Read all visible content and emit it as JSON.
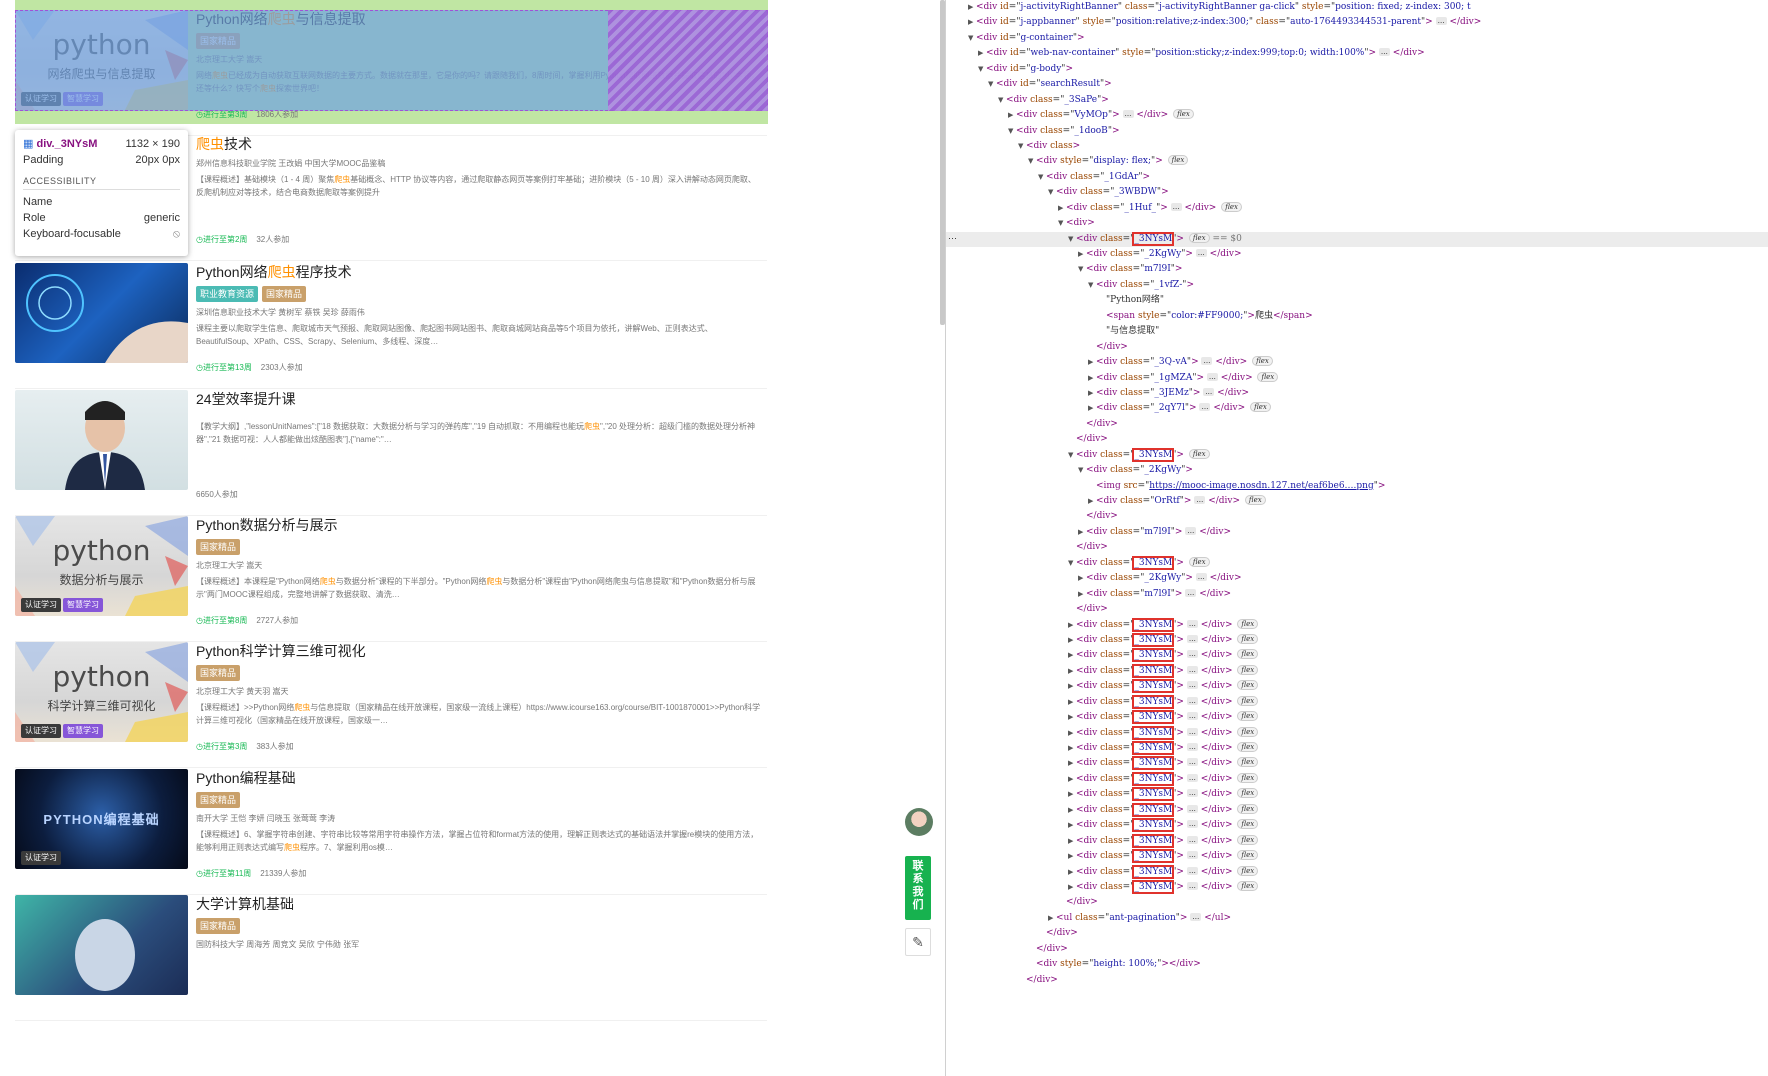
{
  "overlay": {
    "selector": "div._3NYsM",
    "size": "1132 × 190",
    "padding_label": "Padding",
    "padding_value": "20px 0px",
    "section": "ACCESSIBILITY",
    "name_label": "Name",
    "name_value": "",
    "role_label": "Role",
    "role_value": "generic",
    "kf_label": "Keyboard-focusable",
    "kf_icon": "no-entry-icon"
  },
  "courses": [
    {
      "thumb": "python",
      "thumb_word": "python",
      "thumb_sub": "网络爬虫与信息提取",
      "cert": "认证学习",
      "smart": "智慧学习",
      "title_pre": "Python网络",
      "title_hl": "爬虫",
      "title_post": "与信息提取",
      "tags": [
        "国家精品"
      ],
      "teachers": "北京理工大学  嵩天",
      "desc_pre": "网络",
      "desc_hl": "爬虫",
      "desc_post": "已经成为自动获取互联网数据的主要方式。数据就在那里，它是你的吗？请跟随我们，8周时间，掌握利用Python爬取网络数据并提取信息的\"小\"本领，还等什么？快写个",
      "desc_hl2": "爬虫",
      "desc_post2": "探索世界吧！",
      "progress": "进行至第3周",
      "joined": "1806人参加"
    },
    {
      "thumb": "none",
      "title_pre": "",
      "title_hl": "爬虫",
      "title_post": "技术",
      "tags": [],
      "teachers": "郑州信息科技职业学院  王改娟  中国大学MOOC品鉴稿",
      "desc_pre": "【课程概述】基础模块（1 - 4 周）聚焦",
      "desc_hl": "爬虫",
      "desc_post": "基础概念、HTTP 协议等内容，通过爬取静态网页等案例打牢基础；进阶模块（5 - 10 周）深入讲解动态网页爬取、反爬机制应对等技术，结合电商数据爬取等案例提升",
      "desc_hl2": "",
      "desc_post2": "",
      "progress": "进行至第2周",
      "joined": "32人参加"
    },
    {
      "thumb": "tech",
      "title_pre": "Python网络",
      "title_hl": "爬虫",
      "title_post": "程序技术",
      "tags": [
        "职业教育资源",
        "国家精品"
      ],
      "teachers": "深圳信息职业技术大学  黄树军  蔡铁  吴珍  薛雨伟",
      "desc_pre": "课程主要以爬取学生信息、爬取城市天气预报、爬取网站图像、爬起图书网站图书、爬取商城网站商品等5个项目为依托，讲解Web、正则表达式、BeautifulSoup、XPath、CSS、Scrapy、Selenium、多线程、深度…",
      "desc_hl": "",
      "desc_post": "",
      "desc_hl2": "",
      "desc_post2": "",
      "progress": "进行至第13周",
      "joined": "2303人参加"
    },
    {
      "thumb": "person",
      "title_pre": "24堂效率提升课",
      "title_hl": "",
      "title_post": "",
      "tags": [],
      "teachers": "",
      "desc_pre": "【教学大纲】,\"lessonUnitNames\":[\"18 数据获取：大数据分析与学习的弹药库\",\"19 自动抓取：不用编程也能玩",
      "desc_hl": "爬虫",
      "desc_post": "\",\"20 处理分析：超级门槛的数据处理分析神器\",\"21 数据可视：人人都能做出炫酷图表\"],{\"name\":\"…",
      "desc_hl2": "",
      "desc_post2": "",
      "progress": "",
      "joined": "6650人参加"
    },
    {
      "thumb": "python",
      "thumb_word": "python",
      "thumb_sub": "数据分析与展示",
      "cert": "认证学习",
      "smart": "智慧学习",
      "title_pre": "Python数据分析与展示",
      "title_hl": "",
      "title_post": "",
      "tags": [
        "国家精品"
      ],
      "teachers": "北京理工大学  嵩天",
      "desc_pre": "【课程概述】本课程是\"Python网络",
      "desc_hl": "爬虫",
      "desc_post": "与数据分析\"课程的下半部分。\"Python网络",
      "desc_hl2": "爬虫",
      "desc_post2": "与数据分析\"课程由\"Python网络爬虫与信息提取\"和\"Python数据分析与展示\"两门MOOC课程组成，完整地讲解了数据获取、清洗…",
      "progress": "进行至第8周",
      "joined": "2727人参加"
    },
    {
      "thumb": "python",
      "thumb_word": "python",
      "thumb_sub": "科学计算三维可视化",
      "cert": "认证学习",
      "smart": "智慧学习",
      "title_pre": "Python科学计算三维可视化",
      "title_hl": "",
      "title_post": "",
      "tags": [
        "国家精品"
      ],
      "teachers": "北京理工大学  黄天羽  嵩天",
      "desc_pre": "【课程概述】>>Python网络",
      "desc_hl": "爬虫",
      "desc_post": "与信息提取（国家精品在线开放课程，国家级一流线上课程）https://www.icourse163.org/course/BIT-1001870001>>Python科学计算三维可视化（国家精品在线开放课程，国家级一…",
      "desc_hl2": "",
      "desc_post2": "",
      "progress": "进行至第3周",
      "joined": "383人参加"
    },
    {
      "thumb": "dark",
      "thumb_word": "PYTHON编程基础",
      "cert": "认证学习",
      "title_pre": "Python编程基础",
      "title_hl": "",
      "title_post": "",
      "tags": [
        "国家精品"
      ],
      "teachers": "南开大学  王恺  李妍  闫晓玉  张莺莺  李涛",
      "desc_pre": "【课程概述】6、掌握字符串创建、字符串比较等常用字符串操作方法，掌握占位符和format方法的使用，理解正则表达式的基础语法并掌握re模块的使用方法，能够利用正则表达式编写",
      "desc_hl": "爬虫",
      "desc_post": "程序。7、掌握利用os模…",
      "desc_hl2": "",
      "desc_post2": "",
      "progress": "进行至第11周",
      "joined": "21339人参加"
    },
    {
      "thumb": "robot",
      "title_pre": "大学计算机基础",
      "title_hl": "",
      "title_post": "",
      "tags": [
        "国家精品"
      ],
      "teachers": "国防科技大学  周海芳  周竞文  吴欣  宁伟勋  张军",
      "desc_pre": "",
      "desc_hl": "",
      "desc_post": "",
      "desc_hl2": "",
      "desc_post2": "",
      "progress": "",
      "joined": ""
    }
  ],
  "side": {
    "contact": "联系我们",
    "feedback_icon": "edit-icon"
  },
  "devtools": {
    "lines": [
      {
        "i": 0,
        "t": "▶",
        "h": "<span class=\"tg\">&lt;div</span> <span class=\"an\">id</span>=\"<span class=\"av\">j-activityRightBanner</span>\" <span class=\"an\">class</span>=\"<span class=\"av\">j-activityRightBanner ga-click</span>\" <span class=\"an\">style</span>=\"<span class=\"av\">position: fixed; z-index: 300; t</span>"
      },
      {
        "i": 0,
        "t": "▶",
        "h": "<span class=\"tg\">&lt;div</span> <span class=\"an\">id</span>=\"<span class=\"av\">j-appbanner</span>\" <span class=\"an\">style</span>=\"<span class=\"av\">position:relative;z-index:300;</span>\" <span class=\"an\">class</span>=\"<span class=\"av\">auto-1764493344531-parent</span>\"<span class=\"tg\">&gt;</span> <i class=\"ell\">…</i> <span class=\"tg\">&lt;/div&gt;</span>"
      },
      {
        "i": 0,
        "t": "▼",
        "h": "<span class=\"tg\">&lt;div</span> <span class=\"an\">id</span>=\"<span class=\"av\">g-container</span>\"<span class=\"tg\">&gt;</span>"
      },
      {
        "i": 1,
        "t": "▶",
        "h": "<span class=\"tg\">&lt;div</span> <span class=\"an\">id</span>=\"<span class=\"av\">web-nav-container</span>\" <span class=\"an\">style</span>=\"<span class=\"av\">position:sticky;z-index:999;top:0; width:100%</span>\"<span class=\"tg\">&gt;</span> <i class=\"ell\">…</i> <span class=\"tg\">&lt;/div&gt;</span>"
      },
      {
        "i": 1,
        "t": "▼",
        "h": "<span class=\"tg\">&lt;div</span> <span class=\"an\">id</span>=\"<span class=\"av\">g-body</span>\"<span class=\"tg\">&gt;</span>"
      },
      {
        "i": 2,
        "t": "▼",
        "h": "<span class=\"tg\">&lt;div</span> <span class=\"an\">id</span>=\"<span class=\"av\">searchResult</span>\"<span class=\"tg\">&gt;</span>"
      },
      {
        "i": 3,
        "t": "▼",
        "h": "<span class=\"tg\">&lt;div</span> <span class=\"an\">class</span>=\"<span class=\"av\">_3SaPe</span>\"<span class=\"tg\">&gt;</span>"
      },
      {
        "i": 4,
        "t": "▶",
        "h": "<span class=\"tg\">&lt;div</span> <span class=\"an\">class</span>=\"<span class=\"av\">VyMOp</span>\"<span class=\"tg\">&gt;</span> <i class=\"ell\">…</i> <span class=\"tg\">&lt;/div&gt;</span> <i class=\"ev\">flex</i>"
      },
      {
        "i": 4,
        "t": "▼",
        "h": "<span class=\"tg\">&lt;div</span> <span class=\"an\">class</span>=\"<span class=\"av\">_1dooB</span>\"<span class=\"tg\">&gt;</span>"
      },
      {
        "i": 5,
        "t": "▼",
        "h": "<span class=\"tg\">&lt;div</span> <span class=\"an\">class</span><span class=\"tg\">&gt;</span>"
      },
      {
        "i": 6,
        "t": "▼",
        "h": "<span class=\"tg\">&lt;div</span> <span class=\"an\">style</span>=\"<span class=\"av\">display: flex;</span>\"<span class=\"tg\">&gt;</span> <i class=\"ev\">flex</i>"
      },
      {
        "i": 7,
        "t": "▼",
        "h": "<span class=\"tg\">&lt;div</span> <span class=\"an\">class</span>=\"<span class=\"av\">_1GdAr</span>\"<span class=\"tg\">&gt;</span>"
      },
      {
        "i": 8,
        "t": "▼",
        "h": "<span class=\"tg\">&lt;div</span> <span class=\"an\">class</span>=\"<span class=\"av\">_3WBDW</span>\"<span class=\"tg\">&gt;</span>"
      },
      {
        "i": 9,
        "t": "▶",
        "h": "<span class=\"tg\">&lt;div</span> <span class=\"an\">class</span>=\"<span class=\"av\">_1Huf_</span>\"<span class=\"tg\">&gt;</span> <i class=\"ell\">…</i> <span class=\"tg\">&lt;/div&gt;</span> <i class=\"ev\">flex</i>"
      },
      {
        "i": 9,
        "t": "▼",
        "h": "<span class=\"tg\">&lt;div&gt;</span>"
      },
      {
        "i": 10,
        "t": "▼",
        "sel": true,
        "h": "<span class=\"tg\">&lt;div</span> <span class=\"an\">class</span>=\"<span class=\"av box\">_3NYsM</span>\"<span class=\"tg\">&gt;</span> <i class=\"ev\">flex</i> <span style=\"color:#777\">== $0</span>"
      },
      {
        "i": 11,
        "t": "▶",
        "h": "<span class=\"tg\">&lt;div</span> <span class=\"an\">class</span>=\"<span class=\"av\">_2KgWy</span>\"<span class=\"tg\">&gt;</span> <i class=\"ell\">…</i> <span class=\"tg\">&lt;/div&gt;</span>"
      },
      {
        "i": 11,
        "t": "▼",
        "h": "<span class=\"tg\">&lt;div</span> <span class=\"an\">class</span>=\"<span class=\"av\">m7l9I</span>\"<span class=\"tg\">&gt;</span>"
      },
      {
        "i": 12,
        "t": "▼",
        "h": "<span class=\"tg\">&lt;div</span> <span class=\"an\">class</span>=\"<span class=\"av\">_1vfZ-</span>\"<span class=\"tg\">&gt;</span>"
      },
      {
        "i": 13,
        "t": "",
        "h": "\"Python网络\""
      },
      {
        "i": 13,
        "t": "",
        "h": "<span class=\"tg\">&lt;span</span> <span class=\"an\">style</span>=\"<span class=\"av\">color:#FF9000;</span>\"<span class=\"tg\">&gt;</span>爬虫<span class=\"tg\">&lt;/span&gt;</span>"
      },
      {
        "i": 13,
        "t": "",
        "h": "\"与信息提取\""
      },
      {
        "i": 12,
        "t": "",
        "h": "<span class=\"tg\">&lt;/div&gt;</span>"
      },
      {
        "i": 12,
        "t": "▶",
        "h": "<span class=\"tg\">&lt;div</span> <span class=\"an\">class</span>=\"<span class=\"av\">_3Q-vA</span>\"<span class=\"tg\">&gt;</span> <i class=\"ell\">…</i> <span class=\"tg\">&lt;/div&gt;</span> <i class=\"ev\">flex</i>"
      },
      {
        "i": 12,
        "t": "▶",
        "h": "<span class=\"tg\">&lt;div</span> <span class=\"an\">class</span>=\"<span class=\"av\">_1gMZA</span>\"<span class=\"tg\">&gt;</span> <i class=\"ell\">…</i> <span class=\"tg\">&lt;/div&gt;</span> <i class=\"ev\">flex</i>"
      },
      {
        "i": 12,
        "t": "▶",
        "h": "<span class=\"tg\">&lt;div</span> <span class=\"an\">class</span>=\"<span class=\"av\">_3JEMz</span>\"<span class=\"tg\">&gt;</span> <i class=\"ell\">…</i> <span class=\"tg\">&lt;/div&gt;</span>"
      },
      {
        "i": 12,
        "t": "▶",
        "h": "<span class=\"tg\">&lt;div</span> <span class=\"an\">class</span>=\"<span class=\"av\">_2qY7l</span>\"<span class=\"tg\">&gt;</span> <i class=\"ell\">…</i> <span class=\"tg\">&lt;/div&gt;</span> <i class=\"ev\">flex</i>"
      },
      {
        "i": 11,
        "t": "",
        "h": "<span class=\"tg\">&lt;/div&gt;</span>"
      },
      {
        "i": 10,
        "t": "",
        "h": "<span class=\"tg\">&lt;/div&gt;</span>"
      },
      {
        "i": 10,
        "t": "▼",
        "h": "<span class=\"tg\">&lt;div</span> <span class=\"an\">class</span>=\"<span class=\"av box\">_3NYsM</span>\"<span class=\"tg\">&gt;</span> <i class=\"ev\">flex</i>"
      },
      {
        "i": 11,
        "t": "▼",
        "h": "<span class=\"tg\">&lt;div</span> <span class=\"an\">class</span>=\"<span class=\"av\">_2KgWy</span>\"<span class=\"tg\">&gt;</span>"
      },
      {
        "i": 12,
        "t": "",
        "h": "<span class=\"tg\">&lt;img</span> <span class=\"an\">src</span>=\"<span class=\"av\" style=\"text-decoration:underline\">https://mooc-image.nosdn.127.net/eaf6be6….png</span>\"<span class=\"tg\">&gt;</span>"
      },
      {
        "i": 12,
        "t": "▶",
        "h": "<span class=\"tg\">&lt;div</span> <span class=\"an\">class</span>=\"<span class=\"av\">OrRtf</span>\"<span class=\"tg\">&gt;</span> <i class=\"ell\">…</i> <span class=\"tg\">&lt;/div&gt;</span> <i class=\"ev\">flex</i>"
      },
      {
        "i": 11,
        "t": "",
        "h": "<span class=\"tg\">&lt;/div&gt;</span>"
      },
      {
        "i": 11,
        "t": "▶",
        "h": "<span class=\"tg\">&lt;div</span> <span class=\"an\">class</span>=\"<span class=\"av\">m7l9I</span>\"<span class=\"tg\">&gt;</span> <i class=\"ell\">…</i> <span class=\"tg\">&lt;/div&gt;</span>"
      },
      {
        "i": 10,
        "t": "",
        "h": "<span class=\"tg\">&lt;/div&gt;</span>"
      },
      {
        "i": 10,
        "t": "▼",
        "h": "<span class=\"tg\">&lt;div</span> <span class=\"an\">class</span>=\"<span class=\"av box\">_3NYsM</span>\"<span class=\"tg\">&gt;</span> <i class=\"ev\">flex</i>"
      },
      {
        "i": 11,
        "t": "▶",
        "h": "<span class=\"tg\">&lt;div</span> <span class=\"an\">class</span>=\"<span class=\"av\">_2KgWy</span>\"<span class=\"tg\">&gt;</span> <i class=\"ell\">…</i> <span class=\"tg\">&lt;/div&gt;</span>"
      },
      {
        "i": 11,
        "t": "▶",
        "h": "<span class=\"tg\">&lt;div</span> <span class=\"an\">class</span>=\"<span class=\"av\">m7l9I</span>\"<span class=\"tg\">&gt;</span> <i class=\"ell\">…</i> <span class=\"tg\">&lt;/div&gt;</span>"
      },
      {
        "i": 10,
        "t": "",
        "h": "<span class=\"tg\">&lt;/div&gt;</span>"
      },
      {
        "i": 10,
        "t": "▶",
        "rep": true,
        "h": "<span class=\"tg\">&lt;div</span> <span class=\"an\">class</span>=\"<span class=\"av box\">_3NYsM</span>\"<span class=\"tg\">&gt;</span> <i class=\"ell\">…</i> <span class=\"tg\">&lt;/div&gt;</span> <i class=\"ev\">flex</i>"
      },
      {
        "i": 10,
        "t": "▶",
        "h": "<span class=\"tg\">&lt;div</span> <span class=\"an\">class</span>=\"<span class=\"av box\">_3NYsM</span>\"<span class=\"tg\">&gt;</span> <i class=\"ell\">…</i> <span class=\"tg\">&lt;/div&gt;</span> <i class=\"ev\">flex</i>"
      },
      {
        "i": 10,
        "t": "▶",
        "h": "<span class=\"tg\">&lt;div</span> <span class=\"an\">class</span>=\"<span class=\"av box\">_3NYsM</span>\"<span class=\"tg\">&gt;</span> <i class=\"ell\">…</i> <span class=\"tg\">&lt;/div&gt;</span> <i class=\"ev\">flex</i>"
      },
      {
        "i": 10,
        "t": "▶",
        "h": "<span class=\"tg\">&lt;div</span> <span class=\"an\">class</span>=\"<span class=\"av box\">_3NYsM</span>\"<span class=\"tg\">&gt;</span> <i class=\"ell\">…</i> <span class=\"tg\">&lt;/div&gt;</span> <i class=\"ev\">flex</i>"
      },
      {
        "i": 10,
        "t": "▶",
        "h": "<span class=\"tg\">&lt;div</span> <span class=\"an\">class</span>=\"<span class=\"av box\">_3NYsM</span>\"<span class=\"tg\">&gt;</span> <i class=\"ell\">…</i> <span class=\"tg\">&lt;/div&gt;</span> <i class=\"ev\">flex</i>"
      },
      {
        "i": 10,
        "t": "▶",
        "h": "<span class=\"tg\">&lt;div</span> <span class=\"an\">class</span>=\"<span class=\"av box\">_3NYsM</span>\"<span class=\"tg\">&gt;</span> <i class=\"ell\">…</i> <span class=\"tg\">&lt;/div&gt;</span> <i class=\"ev\">flex</i>"
      },
      {
        "i": 10,
        "t": "▶",
        "h": "<span class=\"tg\">&lt;div</span> <span class=\"an\">class</span>=\"<span class=\"av box\">_3NYsM</span>\"<span class=\"tg\">&gt;</span> <i class=\"ell\">…</i> <span class=\"tg\">&lt;/div&gt;</span> <i class=\"ev\">flex</i>"
      },
      {
        "i": 10,
        "t": "▶",
        "h": "<span class=\"tg\">&lt;div</span> <span class=\"an\">class</span>=\"<span class=\"av box\">_3NYsM</span>\"<span class=\"tg\">&gt;</span> <i class=\"ell\">…</i> <span class=\"tg\">&lt;/div&gt;</span> <i class=\"ev\">flex</i>"
      },
      {
        "i": 10,
        "t": "▶",
        "h": "<span class=\"tg\">&lt;div</span> <span class=\"an\">class</span>=\"<span class=\"av box\">_3NYsM</span>\"<span class=\"tg\">&gt;</span> <i class=\"ell\">…</i> <span class=\"tg\">&lt;/div&gt;</span> <i class=\"ev\">flex</i>"
      },
      {
        "i": 10,
        "t": "▶",
        "h": "<span class=\"tg\">&lt;div</span> <span class=\"an\">class</span>=\"<span class=\"av box\">_3NYsM</span>\"<span class=\"tg\">&gt;</span> <i class=\"ell\">…</i> <span class=\"tg\">&lt;/div&gt;</span> <i class=\"ev\">flex</i>"
      },
      {
        "i": 10,
        "t": "▶",
        "h": "<span class=\"tg\">&lt;div</span> <span class=\"an\">class</span>=\"<span class=\"av box\">_3NYsM</span>\"<span class=\"tg\">&gt;</span> <i class=\"ell\">…</i> <span class=\"tg\">&lt;/div&gt;</span> <i class=\"ev\">flex</i>"
      },
      {
        "i": 10,
        "t": "▶",
        "h": "<span class=\"tg\">&lt;div</span> <span class=\"an\">class</span>=\"<span class=\"av box\">_3NYsM</span>\"<span class=\"tg\">&gt;</span> <i class=\"ell\">…</i> <span class=\"tg\">&lt;/div&gt;</span> <i class=\"ev\">flex</i>"
      },
      {
        "i": 10,
        "t": "▶",
        "h": "<span class=\"tg\">&lt;div</span> <span class=\"an\">class</span>=\"<span class=\"av box\">_3NYsM</span>\"<span class=\"tg\">&gt;</span> <i class=\"ell\">…</i> <span class=\"tg\">&lt;/div&gt;</span> <i class=\"ev\">flex</i>"
      },
      {
        "i": 10,
        "t": "▶",
        "h": "<span class=\"tg\">&lt;div</span> <span class=\"an\">class</span>=\"<span class=\"av box\">_3NYsM</span>\"<span class=\"tg\">&gt;</span> <i class=\"ell\">…</i> <span class=\"tg\">&lt;/div&gt;</span> <i class=\"ev\">flex</i>"
      },
      {
        "i": 10,
        "t": "▶",
        "h": "<span class=\"tg\">&lt;div</span> <span class=\"an\">class</span>=\"<span class=\"av box\">_3NYsM</span>\"<span class=\"tg\">&gt;</span> <i class=\"ell\">…</i> <span class=\"tg\">&lt;/div&gt;</span> <i class=\"ev\">flex</i>"
      },
      {
        "i": 10,
        "t": "▶",
        "h": "<span class=\"tg\">&lt;div</span> <span class=\"an\">class</span>=\"<span class=\"av box\">_3NYsM</span>\"<span class=\"tg\">&gt;</span> <i class=\"ell\">…</i> <span class=\"tg\">&lt;/div&gt;</span> <i class=\"ev\">flex</i>"
      },
      {
        "i": 10,
        "t": "▶",
        "h": "<span class=\"tg\">&lt;div</span> <span class=\"an\">class</span>=\"<span class=\"av box\">_3NYsM</span>\"<span class=\"tg\">&gt;</span> <i class=\"ell\">…</i> <span class=\"tg\">&lt;/div&gt;</span> <i class=\"ev\">flex</i>"
      },
      {
        "i": 10,
        "t": "▶",
        "h": "<span class=\"tg\">&lt;div</span> <span class=\"an\">class</span>=\"<span class=\"av box\">_3NYsM</span>\"<span class=\"tg\">&gt;</span> <i class=\"ell\">…</i> <span class=\"tg\">&lt;/div&gt;</span> <i class=\"ev\">flex</i>"
      },
      {
        "i": 9,
        "t": "",
        "h": "<span class=\"tg\">&lt;/div&gt;</span>"
      },
      {
        "i": 8,
        "t": "▶",
        "h": "<span class=\"tg\">&lt;ul</span> <span class=\"an\">class</span>=\"<span class=\"av\">ant-pagination</span>\"<span class=\"tg\">&gt;</span> <i class=\"ell\">…</i> <span class=\"tg\">&lt;/ul&gt;</span>"
      },
      {
        "i": 7,
        "t": "",
        "h": "<span class=\"tg\">&lt;/div&gt;</span>"
      },
      {
        "i": 6,
        "t": "",
        "h": "<span class=\"tg\">&lt;/div&gt;</span>"
      },
      {
        "i": 6,
        "t": "",
        "h": "<span class=\"tg\">&lt;div</span> <span class=\"an\">style</span>=\"<span class=\"av\">height: 100%;</span>\"<span class=\"tg\">&gt;</span><span class=\"tg\">&lt;/div&gt;</span>"
      },
      {
        "i": 5,
        "t": "",
        "h": "<span class=\"tg\">&lt;/div&gt;</span>"
      }
    ]
  }
}
